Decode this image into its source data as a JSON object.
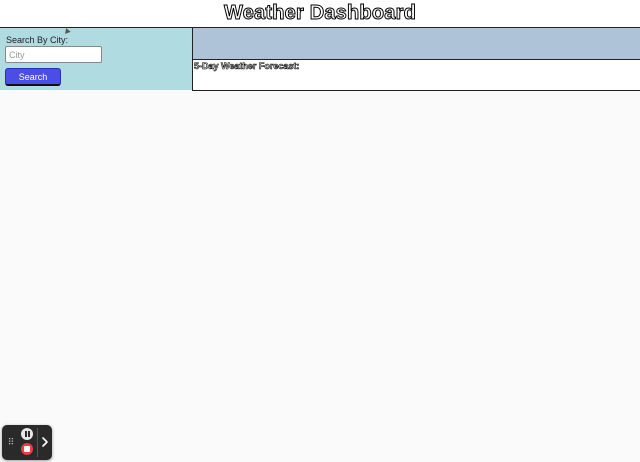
{
  "header": {
    "title": "Weather Dashboard"
  },
  "search": {
    "label": "Search By City:",
    "placeholder": "City",
    "value": "",
    "button_label": "Search"
  },
  "forecast": {
    "title": "5-Day Weather Forecast:"
  },
  "recorder": {
    "grip_icon": "drag-handle-icon",
    "pause_icon": "pause-icon",
    "stop_icon": "stop-icon",
    "expand_icon": "chevron-right-icon"
  },
  "colors": {
    "search_panel_bg": "#b0dbe0",
    "current_weather_bg": "#aec2d8",
    "search_button_bg": "#4a4ee6",
    "page_bg": "#fafafa"
  }
}
